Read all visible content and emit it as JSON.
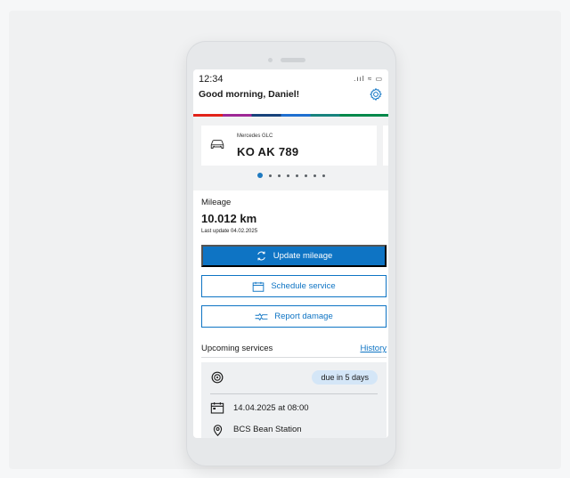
{
  "status_bar": {
    "time": "12:34",
    "icons": ".ııl ≈ ▭"
  },
  "header": {
    "greeting": "Good morning, Daniel!",
    "settings_icon": "gear-icon"
  },
  "vehicle": {
    "model": "Mercedes GLC",
    "plate": "KO AK 789",
    "icon": "car-icon"
  },
  "carousel": {
    "page_count": 8,
    "active_index": 0
  },
  "mileage": {
    "label": "Mileage",
    "value": "10.012 km",
    "last_update": "Last update 04.02.2025"
  },
  "actions": {
    "update_mileage": "Update mileage",
    "schedule_service": "Schedule service",
    "report_damage": "Report damage"
  },
  "upcoming": {
    "label": "Upcoming services",
    "history_link": "History",
    "service": {
      "due": "due in 5 days",
      "date": "14.04.2025 at 08:00",
      "location": "BCS Bean Station"
    }
  },
  "colors": {
    "accent": "#0e74c4",
    "badge": "#d4e6f7",
    "card_bg": "#eef0f2"
  }
}
